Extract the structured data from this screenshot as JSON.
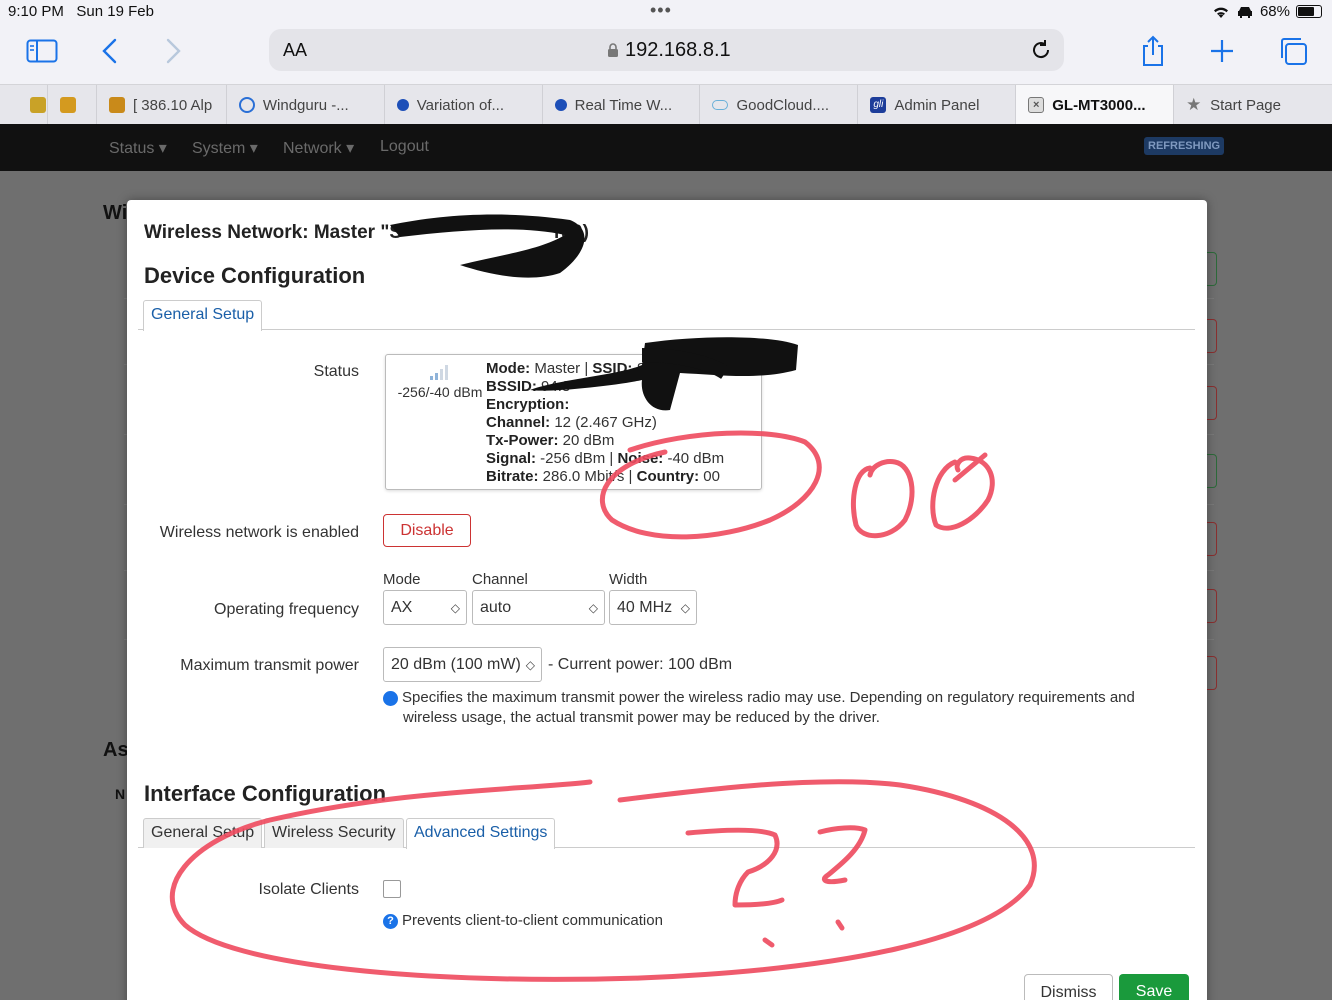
{
  "device_status": {
    "time": "9:10 PM",
    "date": "Sun 19 Feb",
    "battery": "68%",
    "battery_level": 0.68
  },
  "browser": {
    "text_size_label": "AA",
    "url": "192.168.8.1",
    "tabs": [
      {
        "label": "",
        "icon": "hornet-favicon"
      },
      {
        "label": "[ 386.10 Alp",
        "icon": "hornet-favicon"
      },
      {
        "label": "Windguru -...",
        "icon": "windguru-icon"
      },
      {
        "label": "Variation of...",
        "icon": "blue-favicon"
      },
      {
        "label": "Real Time W...",
        "icon": "blue-favicon"
      },
      {
        "label": "GoodCloud....",
        "icon": "cloud-icon"
      },
      {
        "label": "Admin Panel",
        "icon": "gli-favicon"
      },
      {
        "label": "GL-MT3000...",
        "icon": "close-icon"
      },
      {
        "label": "Start Page",
        "icon": "star-icon"
      }
    ]
  },
  "router_nav": {
    "items": [
      "Status",
      "System",
      "Network",
      "Logout"
    ],
    "badge": "REFRESHING"
  },
  "background_page": {
    "heading_1": "Wi",
    "heading_2": "As",
    "column_n": "N"
  },
  "modal": {
    "title": "Wireless Network: Master \"S",
    "title_tail": "ra0)",
    "device_config_heading": "Device Configuration",
    "device_tabs": [
      "General Setup"
    ],
    "status_label": "Status",
    "signal_summary": "-256/-40 dBm",
    "status_lines": [
      {
        "key": "Mode:",
        "value": " Master | ",
        "key2": "SSID:",
        "value2": " S"
      },
      {
        "key": "BSSID:",
        "value": " 94:8",
        "key2": "",
        "value2": ""
      },
      {
        "key": "Encryption:",
        "value": "",
        "key2": "",
        "value2": ""
      },
      {
        "key": "Channel:",
        "value": " 12 (2.467 GHz)",
        "key2": "",
        "value2": ""
      },
      {
        "key": "Tx-Power:",
        "value": " 20 dBm",
        "key2": "",
        "value2": ""
      },
      {
        "key": "Signal:",
        "value": " -256 dBm | ",
        "key2": "Noise:",
        "value2": " -40 dBm"
      },
      {
        "key": "Bitrate:",
        "value": " 286.0 Mbit/s | ",
        "key2": "Country:",
        "value2": " 00"
      }
    ],
    "wireless_enabled_label": "Wireless network is enabled",
    "disable_button": "Disable",
    "operating_frequency_label": "Operating frequency",
    "mode_label": "Mode",
    "channel_label": "Channel",
    "width_label": "Width",
    "mode_value": "AX",
    "channel_value": "auto",
    "width_value": "40 MHz",
    "tx_power_label": "Maximum transmit power",
    "tx_power_value": "20 dBm (100 mW)",
    "current_power_text": "- Current power: 100 dBm",
    "tx_power_help": "Specifies the maximum transmit power the wireless radio may use. Depending on regulatory requirements and wireless usage, the actual transmit power may be reduced by the driver.",
    "interface_config_heading": "Interface Configuration",
    "interface_tabs": [
      "General Setup",
      "Wireless Security",
      "Advanced Settings"
    ],
    "active_interface_tab": "Advanced Settings",
    "isolate_clients_label": "Isolate Clients",
    "isolate_clients_checked": false,
    "isolate_help": "Prevents client-to-client communication",
    "dismiss_button": "Dismiss",
    "save_button": "Save"
  },
  "colors": {
    "accent_blue": "#1a73e8",
    "danger_red": "#cc3333",
    "save_green": "#1a9a3c",
    "annotation_red": "#ee4a5e"
  }
}
